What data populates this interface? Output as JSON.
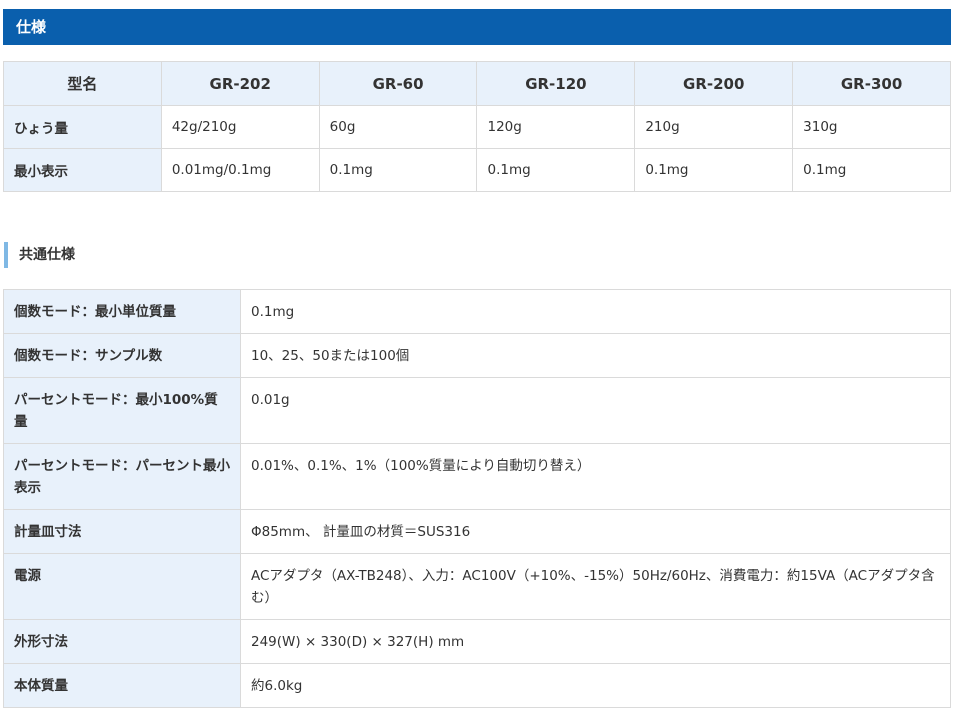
{
  "spec": {
    "title": "仕様"
  },
  "models": {
    "header": [
      "型名",
      "GR-202",
      "GR-60",
      "GR-120",
      "GR-200",
      "GR-300"
    ],
    "rows": [
      {
        "label": "ひょう量",
        "values": [
          "42g/210g",
          "60g",
          "120g",
          "210g",
          "310g"
        ]
      },
      {
        "label": "最小表示",
        "values": [
          "0.01mg/0.1mg",
          "0.1mg",
          "0.1mg",
          "0.1mg",
          "0.1mg"
        ]
      }
    ]
  },
  "common": {
    "title": "共通仕様",
    "rows": [
      {
        "label": "個数モード：最小単位質量",
        "value": "0.1mg"
      },
      {
        "label": "個数モード：サンプル数",
        "value": "10、25、50または100個"
      },
      {
        "label": "パーセントモード：最小100%質量",
        "value": "0.01g"
      },
      {
        "label": "パーセントモード：パーセント最小表示",
        "value": "0.01%、0.1%、1%（100%質量により自動切り替え）"
      },
      {
        "label": "計量皿寸法",
        "value": "Φ85mm、 計量皿の材質＝SUS316"
      },
      {
        "label": "電源",
        "value": "ACアダプタ（AX-TB248）、入力：AC100V（+10%、-15%）50Hz/60Hz、消費電力：約15VA（ACアダプタ含む）"
      },
      {
        "label": "外形寸法",
        "value": "249(W) × 330(D) × 327(H) mm"
      },
      {
        "label": "本体質量",
        "value": "約6.0kg"
      }
    ]
  }
}
